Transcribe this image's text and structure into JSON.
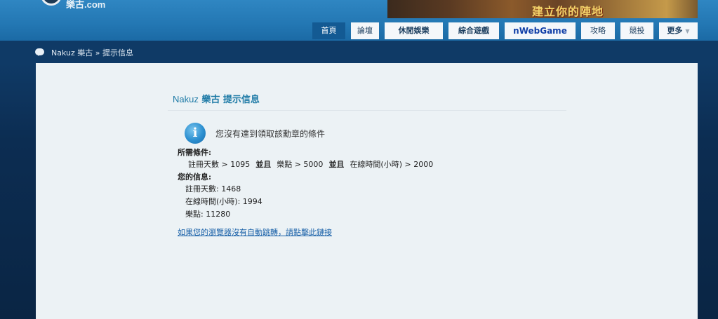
{
  "header": {
    "logo_text": "樂古.com",
    "banner_text": "建立你的陣地"
  },
  "nav": {
    "items": [
      {
        "label": "首頁"
      },
      {
        "label": "論壇"
      },
      {
        "label": "休閒娛樂"
      },
      {
        "label": "綜合遊戲"
      },
      {
        "label": "nWebGame"
      },
      {
        "label": "攻略"
      },
      {
        "label": "競投"
      },
      {
        "label": "更多"
      }
    ],
    "more_caret": "▼"
  },
  "breadcrumb": {
    "text": "Nakuz 樂古 » 提示信息"
  },
  "message_box": {
    "title_brand": "Nakuz",
    "title_rest": "樂古 提示信息",
    "message": "您沒有達到領取該勳章的條件",
    "required_label": "所需條件:",
    "conditions": [
      "註冊天數 > 1095",
      "樂點 > 5000",
      "在線時間(小時) > 2000"
    ],
    "and_label": "並且",
    "your_info_label": "您的信息:",
    "your_info": [
      "註冊天數: 1468",
      "在線時間(小時): 1994",
      "樂點: 11280"
    ],
    "redirect_link": "如果您的瀏覽器沒有自動跳轉，請點擊此鏈接"
  },
  "colors": {
    "header_blue": "#2377b3",
    "page_dark_blue": "#0f3a66",
    "panel_bg": "#ecf2f5",
    "title_color": "#1d7aa6",
    "link_color": "#1860a8",
    "active_tab": "#135a93"
  }
}
